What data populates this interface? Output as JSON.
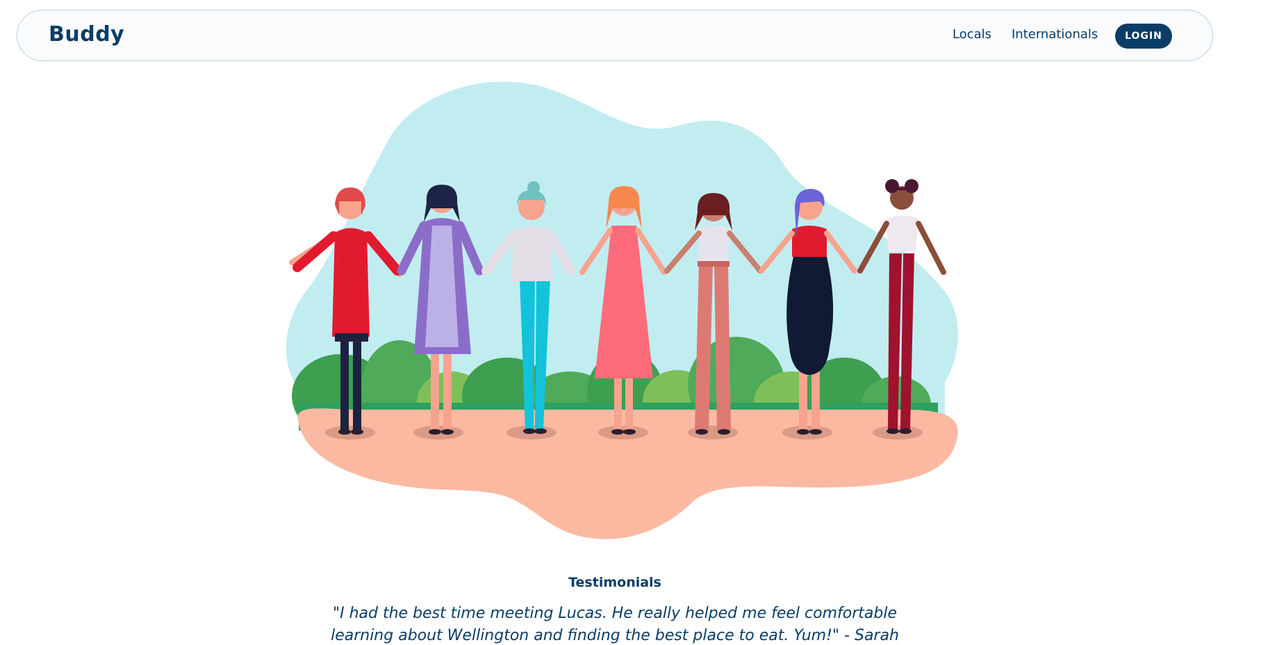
{
  "nav": {
    "brand": "Buddy",
    "links": [
      {
        "label": "Locals"
      },
      {
        "label": "Internationals"
      }
    ],
    "login_label": "LOGIN"
  },
  "testimonials": {
    "heading": "Testimonials",
    "quote": "\"I had the best time meeting Lucas. He really helped me feel comfortable learning about Wellington and finding the best place to eat. Yum!\" - Sarah"
  },
  "colors": {
    "primary": "#0a3d66",
    "sky": "#c1edf1",
    "ground": "#fbb9a2",
    "bush_dark": "#3f9f50",
    "bush_light": "#7fbf5a"
  }
}
